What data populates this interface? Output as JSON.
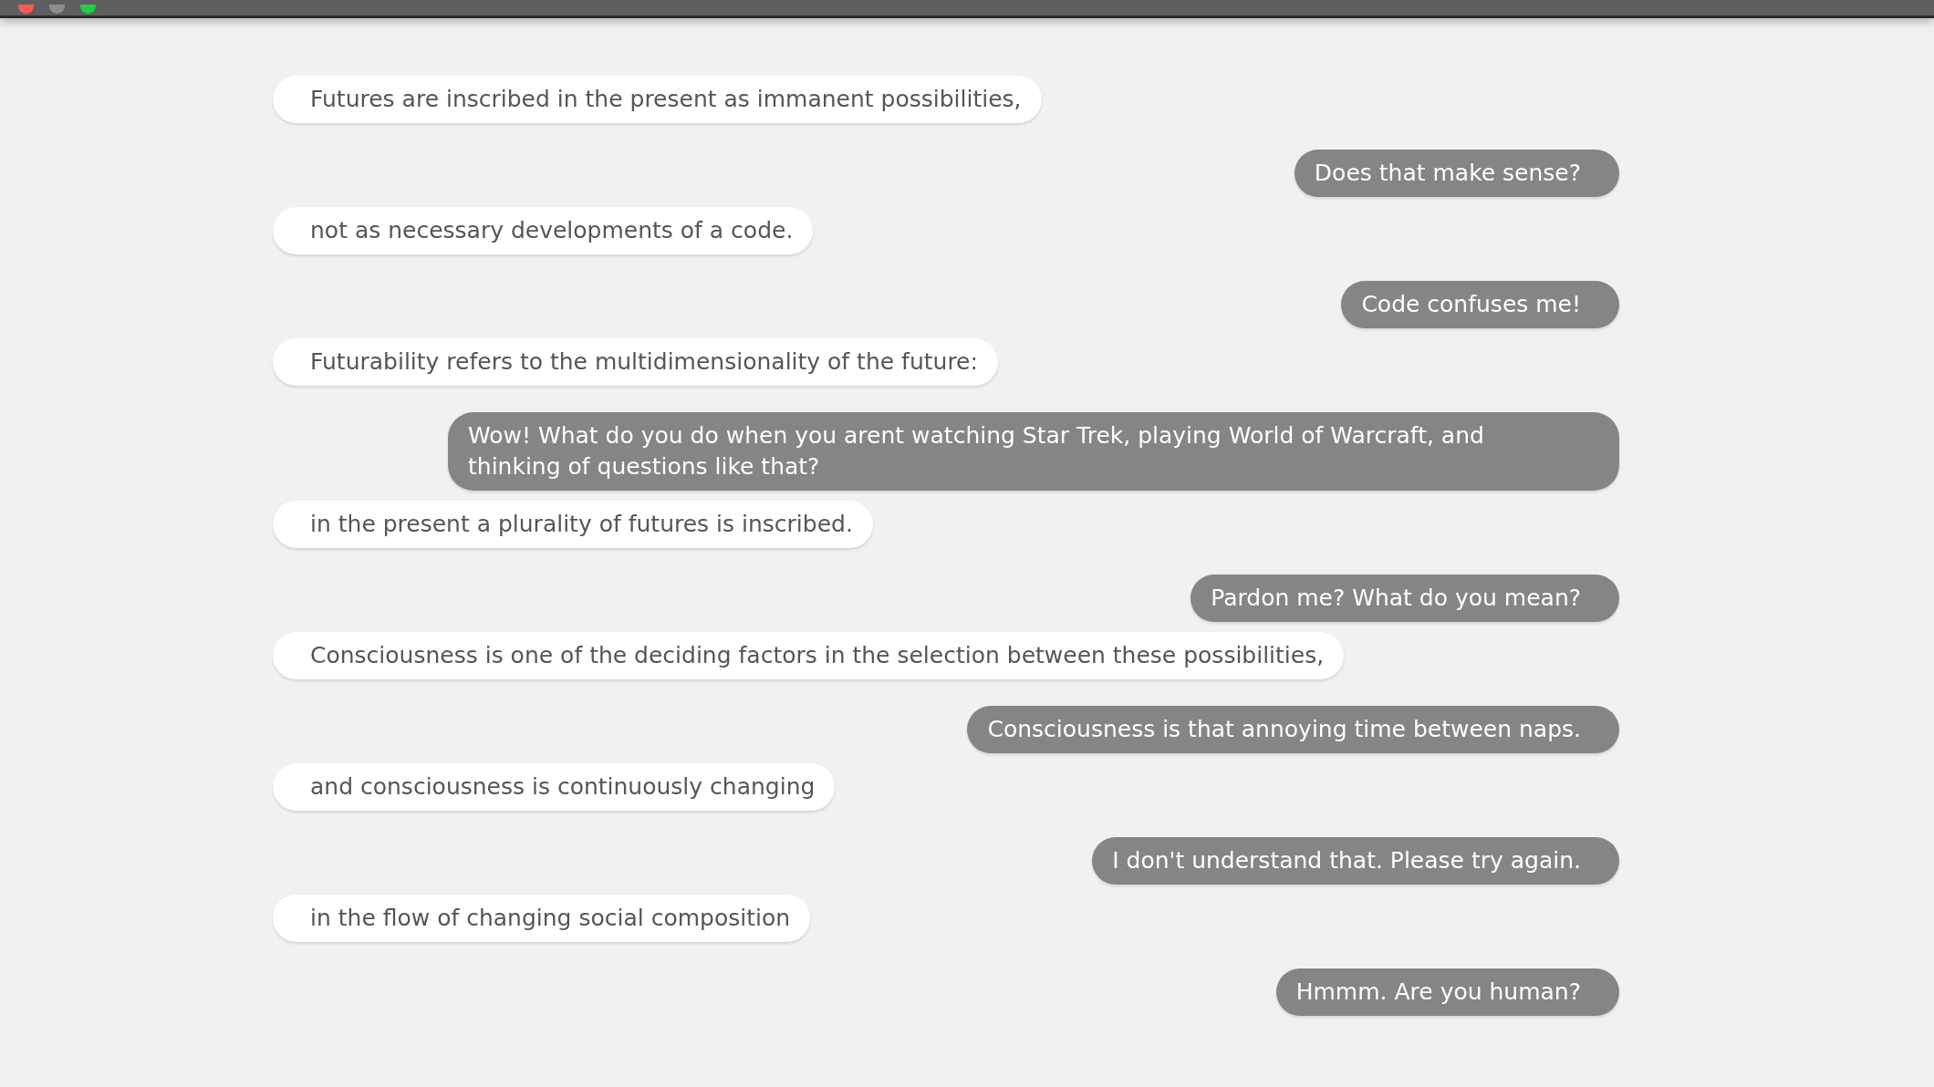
{
  "messages": [
    {
      "kind": "bot",
      "text": "Futures are inscribed in the present as immanent possibilities,"
    },
    {
      "kind": "user",
      "text": "Does that make sense?"
    },
    {
      "kind": "bot",
      "text": "not as necessary developments of a code."
    },
    {
      "kind": "user",
      "text": "Code confuses me!"
    },
    {
      "kind": "bot",
      "text": "Futurability refers to the multidimensionality of the future:"
    },
    {
      "kind": "user",
      "text": "Wow! What do you do when you arent watching Star Trek, playing World of Warcraft, and thinking of questions like that?"
    },
    {
      "kind": "bot",
      "text": "in the present a plurality of futures is inscribed."
    },
    {
      "kind": "user",
      "text": "Pardon me? What do you mean?"
    },
    {
      "kind": "bot",
      "text": "Consciousness is one of the deciding factors in the selection between these possibilities,"
    },
    {
      "kind": "user",
      "text": "Consciousness is that annoying time between naps."
    },
    {
      "kind": "bot",
      "text": "and consciousness is continuously changing"
    },
    {
      "kind": "user",
      "text": "I don't understand that. Please try again."
    },
    {
      "kind": "bot",
      "text": "in the flow of changing social composition"
    },
    {
      "kind": "user",
      "text": "Hmmm. Are you human?"
    }
  ]
}
